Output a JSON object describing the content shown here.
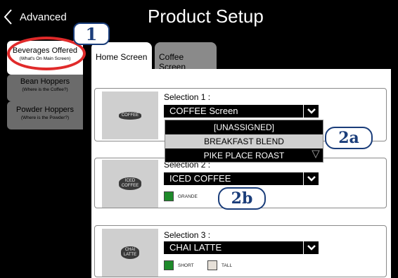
{
  "header": {
    "back_label": "Advanced",
    "title": "Product Setup"
  },
  "sidebar": {
    "items": [
      {
        "title": "Beverages Offered",
        "subtitle": "(What's On Main Screen)",
        "active": true
      },
      {
        "title": "Bean Hoppers",
        "subtitle": "(Where is the Coffee?)",
        "active": false
      },
      {
        "title": "Powder Hoppers",
        "subtitle": "(Where is the Powder?)",
        "active": false
      }
    ]
  },
  "tabs": [
    {
      "label": "Home Screen",
      "active": true
    },
    {
      "label": "Coffee Screen",
      "active": false
    }
  ],
  "selections": [
    {
      "label": "Selection 1 :",
      "value": "COFFEE Screen",
      "thumb_text": "COFFEE",
      "sizes": []
    },
    {
      "label": "Selection 2 :",
      "value": "ICED COFFEE",
      "thumb_text": "ICED\nCOFFEE",
      "sizes": [
        {
          "label": "GRANDE",
          "checked": true
        }
      ]
    },
    {
      "label": "Selection 3 :",
      "value": "CHAI LATTE",
      "thumb_text": "CHAI\nLATTE",
      "sizes": [
        {
          "label": "SHORT",
          "checked": true
        },
        {
          "label": "TALL",
          "checked": false
        }
      ]
    }
  ],
  "dropdown_open": {
    "options": [
      "[UNASSIGNED]",
      "BREAKFAST BLEND",
      "PIKE PLACE ROAST"
    ],
    "highlighted": "BREAKFAST BLEND"
  },
  "callouts": [
    "1",
    "2a",
    "2b"
  ],
  "colors": {
    "checkbox_on": "#1e8a2a",
    "callout_border": "#1a3d7a",
    "highlight_circle": "#e02a2a"
  }
}
